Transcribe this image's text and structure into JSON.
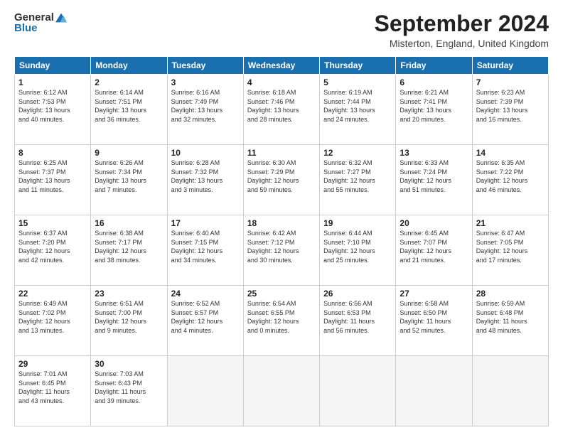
{
  "logo": {
    "general": "General",
    "blue": "Blue"
  },
  "title": "September 2024",
  "location": "Misterton, England, United Kingdom",
  "days_of_week": [
    "Sunday",
    "Monday",
    "Tuesday",
    "Wednesday",
    "Thursday",
    "Friday",
    "Saturday"
  ],
  "weeks": [
    [
      {
        "day": "1",
        "info": "Sunrise: 6:12 AM\nSunset: 7:53 PM\nDaylight: 13 hours\nand 40 minutes."
      },
      {
        "day": "2",
        "info": "Sunrise: 6:14 AM\nSunset: 7:51 PM\nDaylight: 13 hours\nand 36 minutes."
      },
      {
        "day": "3",
        "info": "Sunrise: 6:16 AM\nSunset: 7:49 PM\nDaylight: 13 hours\nand 32 minutes."
      },
      {
        "day": "4",
        "info": "Sunrise: 6:18 AM\nSunset: 7:46 PM\nDaylight: 13 hours\nand 28 minutes."
      },
      {
        "day": "5",
        "info": "Sunrise: 6:19 AM\nSunset: 7:44 PM\nDaylight: 13 hours\nand 24 minutes."
      },
      {
        "day": "6",
        "info": "Sunrise: 6:21 AM\nSunset: 7:41 PM\nDaylight: 13 hours\nand 20 minutes."
      },
      {
        "day": "7",
        "info": "Sunrise: 6:23 AM\nSunset: 7:39 PM\nDaylight: 13 hours\nand 16 minutes."
      }
    ],
    [
      {
        "day": "8",
        "info": "Sunrise: 6:25 AM\nSunset: 7:37 PM\nDaylight: 13 hours\nand 11 minutes."
      },
      {
        "day": "9",
        "info": "Sunrise: 6:26 AM\nSunset: 7:34 PM\nDaylight: 13 hours\nand 7 minutes."
      },
      {
        "day": "10",
        "info": "Sunrise: 6:28 AM\nSunset: 7:32 PM\nDaylight: 13 hours\nand 3 minutes."
      },
      {
        "day": "11",
        "info": "Sunrise: 6:30 AM\nSunset: 7:29 PM\nDaylight: 12 hours\nand 59 minutes."
      },
      {
        "day": "12",
        "info": "Sunrise: 6:32 AM\nSunset: 7:27 PM\nDaylight: 12 hours\nand 55 minutes."
      },
      {
        "day": "13",
        "info": "Sunrise: 6:33 AM\nSunset: 7:24 PM\nDaylight: 12 hours\nand 51 minutes."
      },
      {
        "day": "14",
        "info": "Sunrise: 6:35 AM\nSunset: 7:22 PM\nDaylight: 12 hours\nand 46 minutes."
      }
    ],
    [
      {
        "day": "15",
        "info": "Sunrise: 6:37 AM\nSunset: 7:20 PM\nDaylight: 12 hours\nand 42 minutes."
      },
      {
        "day": "16",
        "info": "Sunrise: 6:38 AM\nSunset: 7:17 PM\nDaylight: 12 hours\nand 38 minutes."
      },
      {
        "day": "17",
        "info": "Sunrise: 6:40 AM\nSunset: 7:15 PM\nDaylight: 12 hours\nand 34 minutes."
      },
      {
        "day": "18",
        "info": "Sunrise: 6:42 AM\nSunset: 7:12 PM\nDaylight: 12 hours\nand 30 minutes."
      },
      {
        "day": "19",
        "info": "Sunrise: 6:44 AM\nSunset: 7:10 PM\nDaylight: 12 hours\nand 25 minutes."
      },
      {
        "day": "20",
        "info": "Sunrise: 6:45 AM\nSunset: 7:07 PM\nDaylight: 12 hours\nand 21 minutes."
      },
      {
        "day": "21",
        "info": "Sunrise: 6:47 AM\nSunset: 7:05 PM\nDaylight: 12 hours\nand 17 minutes."
      }
    ],
    [
      {
        "day": "22",
        "info": "Sunrise: 6:49 AM\nSunset: 7:02 PM\nDaylight: 12 hours\nand 13 minutes."
      },
      {
        "day": "23",
        "info": "Sunrise: 6:51 AM\nSunset: 7:00 PM\nDaylight: 12 hours\nand 9 minutes."
      },
      {
        "day": "24",
        "info": "Sunrise: 6:52 AM\nSunset: 6:57 PM\nDaylight: 12 hours\nand 4 minutes."
      },
      {
        "day": "25",
        "info": "Sunrise: 6:54 AM\nSunset: 6:55 PM\nDaylight: 12 hours\nand 0 minutes."
      },
      {
        "day": "26",
        "info": "Sunrise: 6:56 AM\nSunset: 6:53 PM\nDaylight: 11 hours\nand 56 minutes."
      },
      {
        "day": "27",
        "info": "Sunrise: 6:58 AM\nSunset: 6:50 PM\nDaylight: 11 hours\nand 52 minutes."
      },
      {
        "day": "28",
        "info": "Sunrise: 6:59 AM\nSunset: 6:48 PM\nDaylight: 11 hours\nand 48 minutes."
      }
    ],
    [
      {
        "day": "29",
        "info": "Sunrise: 7:01 AM\nSunset: 6:45 PM\nDaylight: 11 hours\nand 43 minutes."
      },
      {
        "day": "30",
        "info": "Sunrise: 7:03 AM\nSunset: 6:43 PM\nDaylight: 11 hours\nand 39 minutes."
      },
      {
        "day": "",
        "info": ""
      },
      {
        "day": "",
        "info": ""
      },
      {
        "day": "",
        "info": ""
      },
      {
        "day": "",
        "info": ""
      },
      {
        "day": "",
        "info": ""
      }
    ]
  ]
}
